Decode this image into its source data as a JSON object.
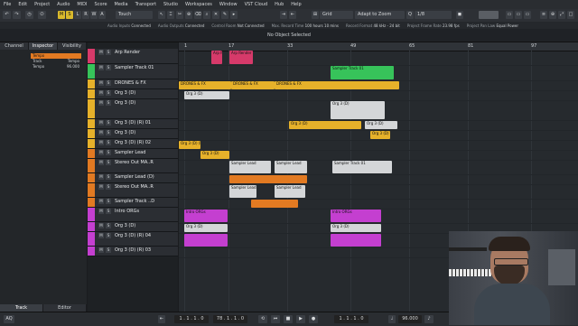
{
  "menu": [
    "File",
    "Edit",
    "Project",
    "Audio",
    "MIDI",
    "Score",
    "Media",
    "Transport",
    "Studio",
    "Workspaces",
    "Window",
    "VST Cloud",
    "Hub",
    "Help"
  ],
  "toolbar": {
    "m_label": "M",
    "s_label": "S",
    "l_label": "L",
    "r_label": "R",
    "w_label": "W",
    "a_label": "A",
    "tool_mode": "Touch",
    "grid_label": "Grid",
    "snap_label": "Adapt to Zoom",
    "quantize_label": "1/8"
  },
  "statusbar": {
    "audio_inputs_label": "Audio Inputs",
    "audio_inputs_value": "Connected",
    "audio_outputs_label": "Audio Outputs",
    "audio_outputs_value": "Connected",
    "control_room_label": "Control Room",
    "control_room_value": "Not Connected",
    "max_record_label": "Max. Record Time",
    "max_record_value": "100 hours 10 mins",
    "record_format_label": "Record Format",
    "record_format_value": "48 kHz - 24 bit",
    "frame_rate_label": "Project Frame Rate",
    "frame_rate_value": "23.98 fps",
    "pan_law_label": "Project Pan Law",
    "pan_law_value": "Equal Power"
  },
  "info_line": "No Object Selected",
  "left_zone": {
    "tabs": [
      "Channel",
      "Inspector",
      "Visibility"
    ],
    "inspector_rows": [
      {
        "label": "Tempo",
        "value": ""
      },
      {
        "label": "Track",
        "value": "Tempo"
      },
      {
        "label": "Tempo",
        "value": "96.000"
      }
    ],
    "bottom_tabs": [
      "Track",
      "Editor"
    ]
  },
  "tracks": [
    {
      "name": "Arp Render",
      "color": "#d63a6a",
      "folder": false
    },
    {
      "name": "Sampler Track 01",
      "color": "#37c35a",
      "folder": false
    },
    {
      "name": "DRONES & FX",
      "color": "#e6b12a",
      "folder": true
    },
    {
      "name": "Org 3 (D)",
      "color": "#e6b12a",
      "folder": false
    },
    {
      "name": "Org 3 (D)",
      "color": "#e6b12a",
      "folder": false
    },
    {
      "name": "Org 3 (D) (R) 01",
      "color": "#e6b12a",
      "folder": false
    },
    {
      "name": "Org 3 (D)",
      "color": "#e6b12a",
      "folder": false
    },
    {
      "name": "Org 3 (D) (R) 02",
      "color": "#e6b12a",
      "folder": false
    },
    {
      "name": "Sampler Lead",
      "color": "#e27a22",
      "folder": false
    },
    {
      "name": "Stereo Out MA..R",
      "color": "#e27a22",
      "folder": false
    },
    {
      "name": "Sampler Lead (D)",
      "color": "#e27a22",
      "folder": false
    },
    {
      "name": "Stereo Out MA..R",
      "color": "#e27a22",
      "folder": false
    },
    {
      "name": "Sampler Track ..D",
      "color": "#e27a22",
      "folder": false
    },
    {
      "name": "Intro ORGs",
      "color": "#c43fd0",
      "folder": true
    },
    {
      "name": "Org 3 (D)",
      "color": "#c43fd0",
      "folder": false
    },
    {
      "name": "Org 3 (D) (R) 04",
      "color": "#c43fd0",
      "folder": false
    },
    {
      "name": "Org 3 (D) (R) 03",
      "color": "#c43fd0",
      "folder": false
    }
  ],
  "ruler": [
    "1",
    "17",
    "33",
    "49",
    "65",
    "81",
    "97"
  ],
  "events": [
    {
      "label": "Arp Render",
      "color": "#d63a6a"
    },
    {
      "label": "Arp Render",
      "color": "#d63a6a"
    },
    {
      "label": "Sampler Track 01",
      "color": "#37c35a"
    },
    {
      "label": "DRONES & FX",
      "color": "#e6b12a"
    },
    {
      "label": "DRONES & FX",
      "color": "#e6b12a"
    },
    {
      "label": "DRONES & FX",
      "color": "#e6b12a"
    },
    {
      "label": "Org 3 (D)",
      "color": "#d4d6d8"
    },
    {
      "label": "Org 3 (D)",
      "color": "#d4d6d8"
    },
    {
      "label": "Org 3 (D)",
      "color": "#e6b12a"
    },
    {
      "label": "Org 3 (D)",
      "color": "#d4d6d8"
    },
    {
      "label": "Org 3 (D)",
      "color": "#e6b12a"
    },
    {
      "label": "Org 3 (D) (R)",
      "color": "#e6b12a"
    },
    {
      "label": "Org 3 (D)",
      "color": "#e6b12a"
    },
    {
      "label": "Sampler Lead",
      "color": "#d4d6d8"
    },
    {
      "label": "Sampler Lead",
      "color": "#d4d6d8"
    },
    {
      "label": "Sampler Track 01",
      "color": "#d4d6d8"
    },
    {
      "label": "",
      "color": "#e27a22"
    },
    {
      "label": "Sampler Lead",
      "color": "#d4d6d8"
    },
    {
      "label": "Sampler Lead",
      "color": "#d4d6d8"
    },
    {
      "label": "",
      "color": "#e27a22"
    },
    {
      "label": "Intro ORGs",
      "color": "#c43fd0"
    },
    {
      "label": "Intro ORGs",
      "color": "#c43fd0"
    },
    {
      "label": "Org 3 (D)",
      "color": "#d4d6d8"
    },
    {
      "label": "Org 3 (D)",
      "color": "#d4d6d8"
    },
    {
      "label": "",
      "color": "#c43fd0"
    },
    {
      "label": "",
      "color": "#c43fd0"
    }
  ],
  "transport": {
    "position_left": "1 . 1 . 1 . 0",
    "position_right": "1 . 1 . 1 . 0",
    "tempo": "96.000",
    "bar_position": "78 . 1 . 1 . 0"
  }
}
